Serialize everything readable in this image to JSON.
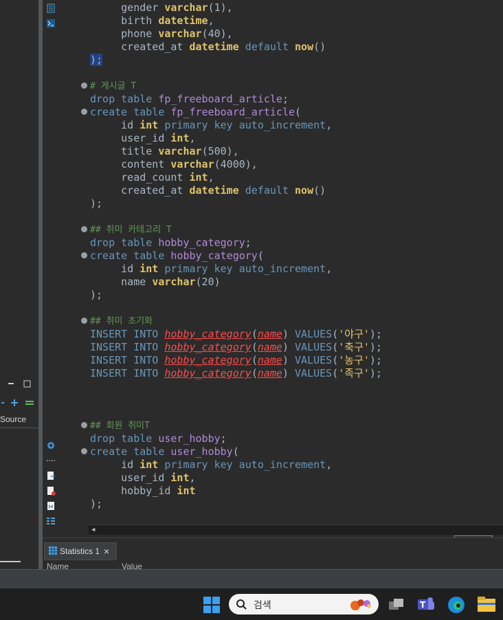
{
  "editor": {
    "table1_lines": {
      "gender": "gender",
      "birth": "birth",
      "phone": "phone",
      "created_at": "created_at",
      "varchar": "varchar",
      "datetime": "datetime",
      "default": "default",
      "now": "now",
      "gender_args": "(1),",
      "birth_tail": ",",
      "phone_args": "(40),",
      "now_parens": "()",
      "close": ");"
    },
    "comment_board": "게시글 T",
    "comment_category": "## 취미 카테고리 T",
    "comment_init": "## 취미 초기화",
    "comment_user_hobby": "## 회원 취미T",
    "kw": {
      "drop": "drop",
      "table": "table",
      "create": "create",
      "int": "int",
      "primary": "primary",
      "key": "key",
      "auto_increment": "auto_increment",
      "insert": "INSERT",
      "into": "INTO",
      "values": "VALUES"
    },
    "names": {
      "fp_freeboard_article": "fp_freeboard_article",
      "hobby_category": "hobby_category",
      "user_hobby": "user_hobby",
      "id": "id",
      "user_id": "user_id",
      "title": "title",
      "content": "content",
      "read_count": "read_count",
      "name": "name",
      "hobby_id": "hobby_id"
    },
    "args": {
      "v500": "(500),",
      "v4000": "(4000),",
      "v20": "(20)"
    },
    "inserts": [
      "'야구'",
      "'축구'",
      "'농구'",
      "'족구'"
    ]
  },
  "left_panel": {
    "source_label": "Source"
  },
  "bottom_panel": {
    "tab_label": "Statistics 1",
    "col_name": "Name",
    "col_value": "Value"
  },
  "taskbar": {
    "search_placeholder": "검색"
  }
}
